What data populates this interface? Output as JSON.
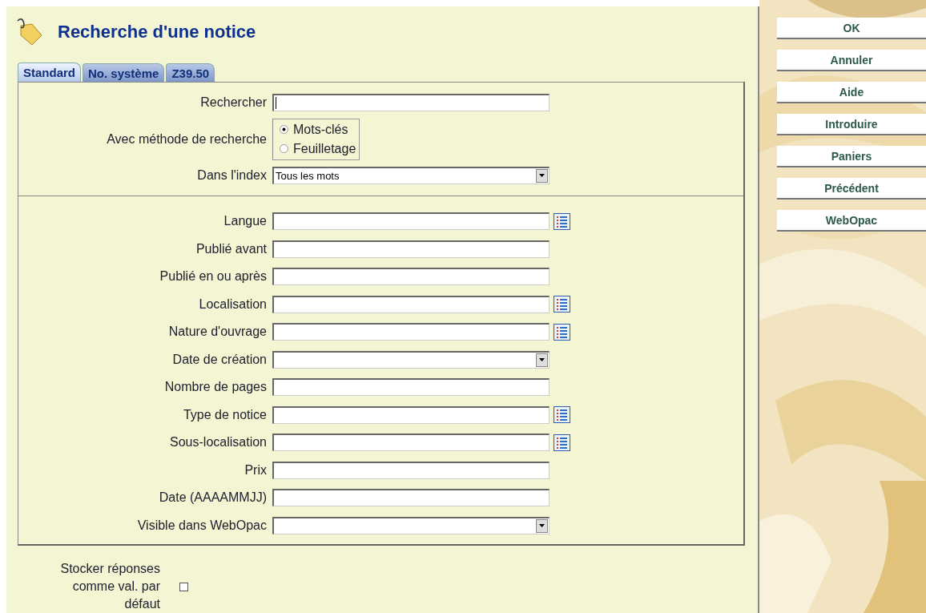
{
  "title": "Recherche d'une notice",
  "tabs": [
    {
      "label": "Standard",
      "selected": true
    },
    {
      "label": "No. système",
      "selected": false
    },
    {
      "label": "Z39.50",
      "selected": false
    }
  ],
  "search_fields": [
    {
      "kind": "text",
      "label": "Rechercher",
      "focused": true
    },
    {
      "kind": "radio",
      "label": "Avec méthode de recherche",
      "options": [
        {
          "label": "Mots-clés",
          "selected": true
        },
        {
          "label": "Feuilletage",
          "selected": false
        }
      ]
    },
    {
      "kind": "select",
      "label": "Dans l'index",
      "value": "Tous les mots"
    }
  ],
  "filters": [
    {
      "kind": "list",
      "label": "Langue"
    },
    {
      "kind": "text",
      "label": "Publié avant"
    },
    {
      "kind": "text",
      "label": "Publié en ou après"
    },
    {
      "kind": "list",
      "label": "Localisation"
    },
    {
      "kind": "list",
      "label": "Nature d'ouvrage"
    },
    {
      "kind": "select",
      "label": "Date de création"
    },
    {
      "kind": "text",
      "label": "Nombre de pages"
    },
    {
      "kind": "list",
      "label": "Type de notice"
    },
    {
      "kind": "list",
      "label": "Sous-localisation"
    },
    {
      "kind": "text",
      "label": "Prix"
    },
    {
      "kind": "text",
      "label": "Date (AAAAMMJJ)"
    },
    {
      "kind": "select",
      "label": "Visible dans WebOpac"
    }
  ],
  "store_default": {
    "label": "Stocker réponses comme val. par défaut",
    "checked": false
  },
  "buttons": [
    {
      "label": "OK"
    },
    {
      "label": "Annuler"
    },
    {
      "label": "Aide"
    },
    {
      "label": "Introduire"
    },
    {
      "label": "Paniers"
    },
    {
      "label": "Précédent"
    },
    {
      "label": "WebOpac"
    }
  ]
}
